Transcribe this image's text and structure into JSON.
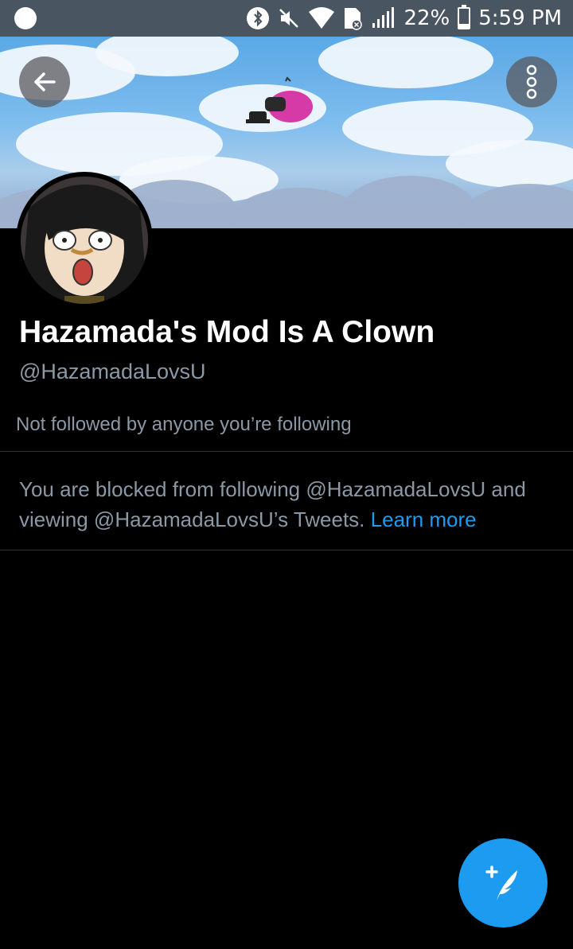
{
  "status_bar": {
    "battery_percent": "22%",
    "battery_level": 0.22,
    "time": "5:59 PM",
    "icons": [
      "notification-dot-icon",
      "bluetooth-icon",
      "mute-icon",
      "wifi-icon",
      "sim-blocked-icon",
      "signal-icon",
      "battery-icon"
    ]
  },
  "header": {
    "back_icon": "arrow-left-icon",
    "more_icon": "more-vertical-icon"
  },
  "profile": {
    "display_name": "Hazamada's Mod Is A Clown",
    "handle": "@HazamadaLovsU",
    "followers_note": "Not followed by anyone you’re following"
  },
  "blocked_notice": {
    "message": "You are blocked from following @HazamadaLovsU and viewing @HazamadaLovsU’s Tweets.",
    "link_label": "Learn more"
  },
  "fab": {
    "icon": "compose-tweet-icon"
  },
  "colors": {
    "background": "#000000",
    "status_bar": "#4a5562",
    "secondary_text": "#8b98a5",
    "accent": "#1d9bf0"
  }
}
